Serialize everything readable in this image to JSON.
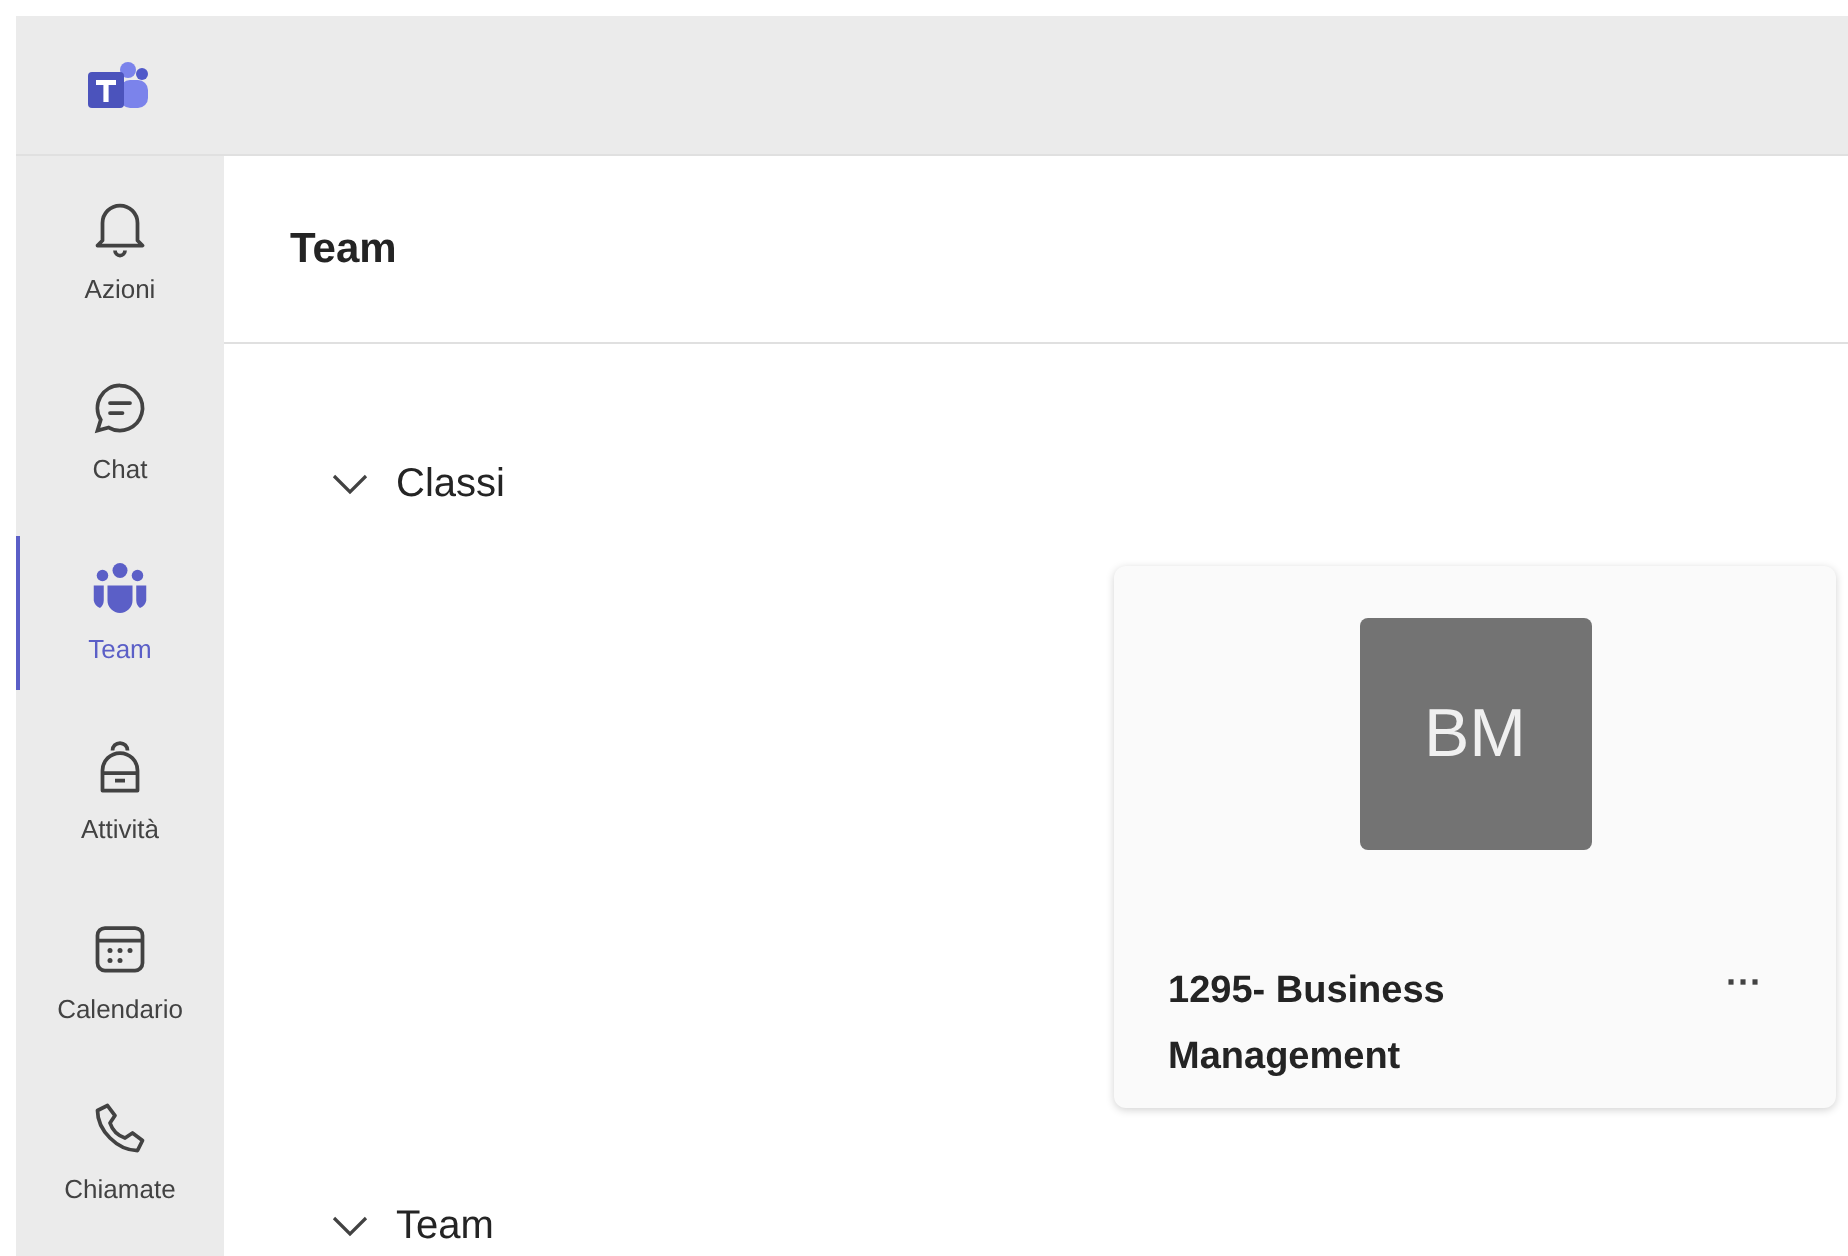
{
  "rail": [
    {
      "label": "Azioni",
      "selected": false
    },
    {
      "label": "Chat",
      "selected": false
    },
    {
      "label": "Team",
      "selected": true
    },
    {
      "label": "Attività",
      "selected": false
    },
    {
      "label": "Calendario",
      "selected": false
    },
    {
      "label": "Chiamate",
      "selected": false
    }
  ],
  "header": {
    "title": "Team"
  },
  "sections": [
    {
      "label": "Classi",
      "expanded": true,
      "teams": [
        {
          "initials": "BM",
          "name": "1295- Business Management",
          "more": "···"
        }
      ]
    },
    {
      "label": "Team",
      "expanded": true
    }
  ]
}
